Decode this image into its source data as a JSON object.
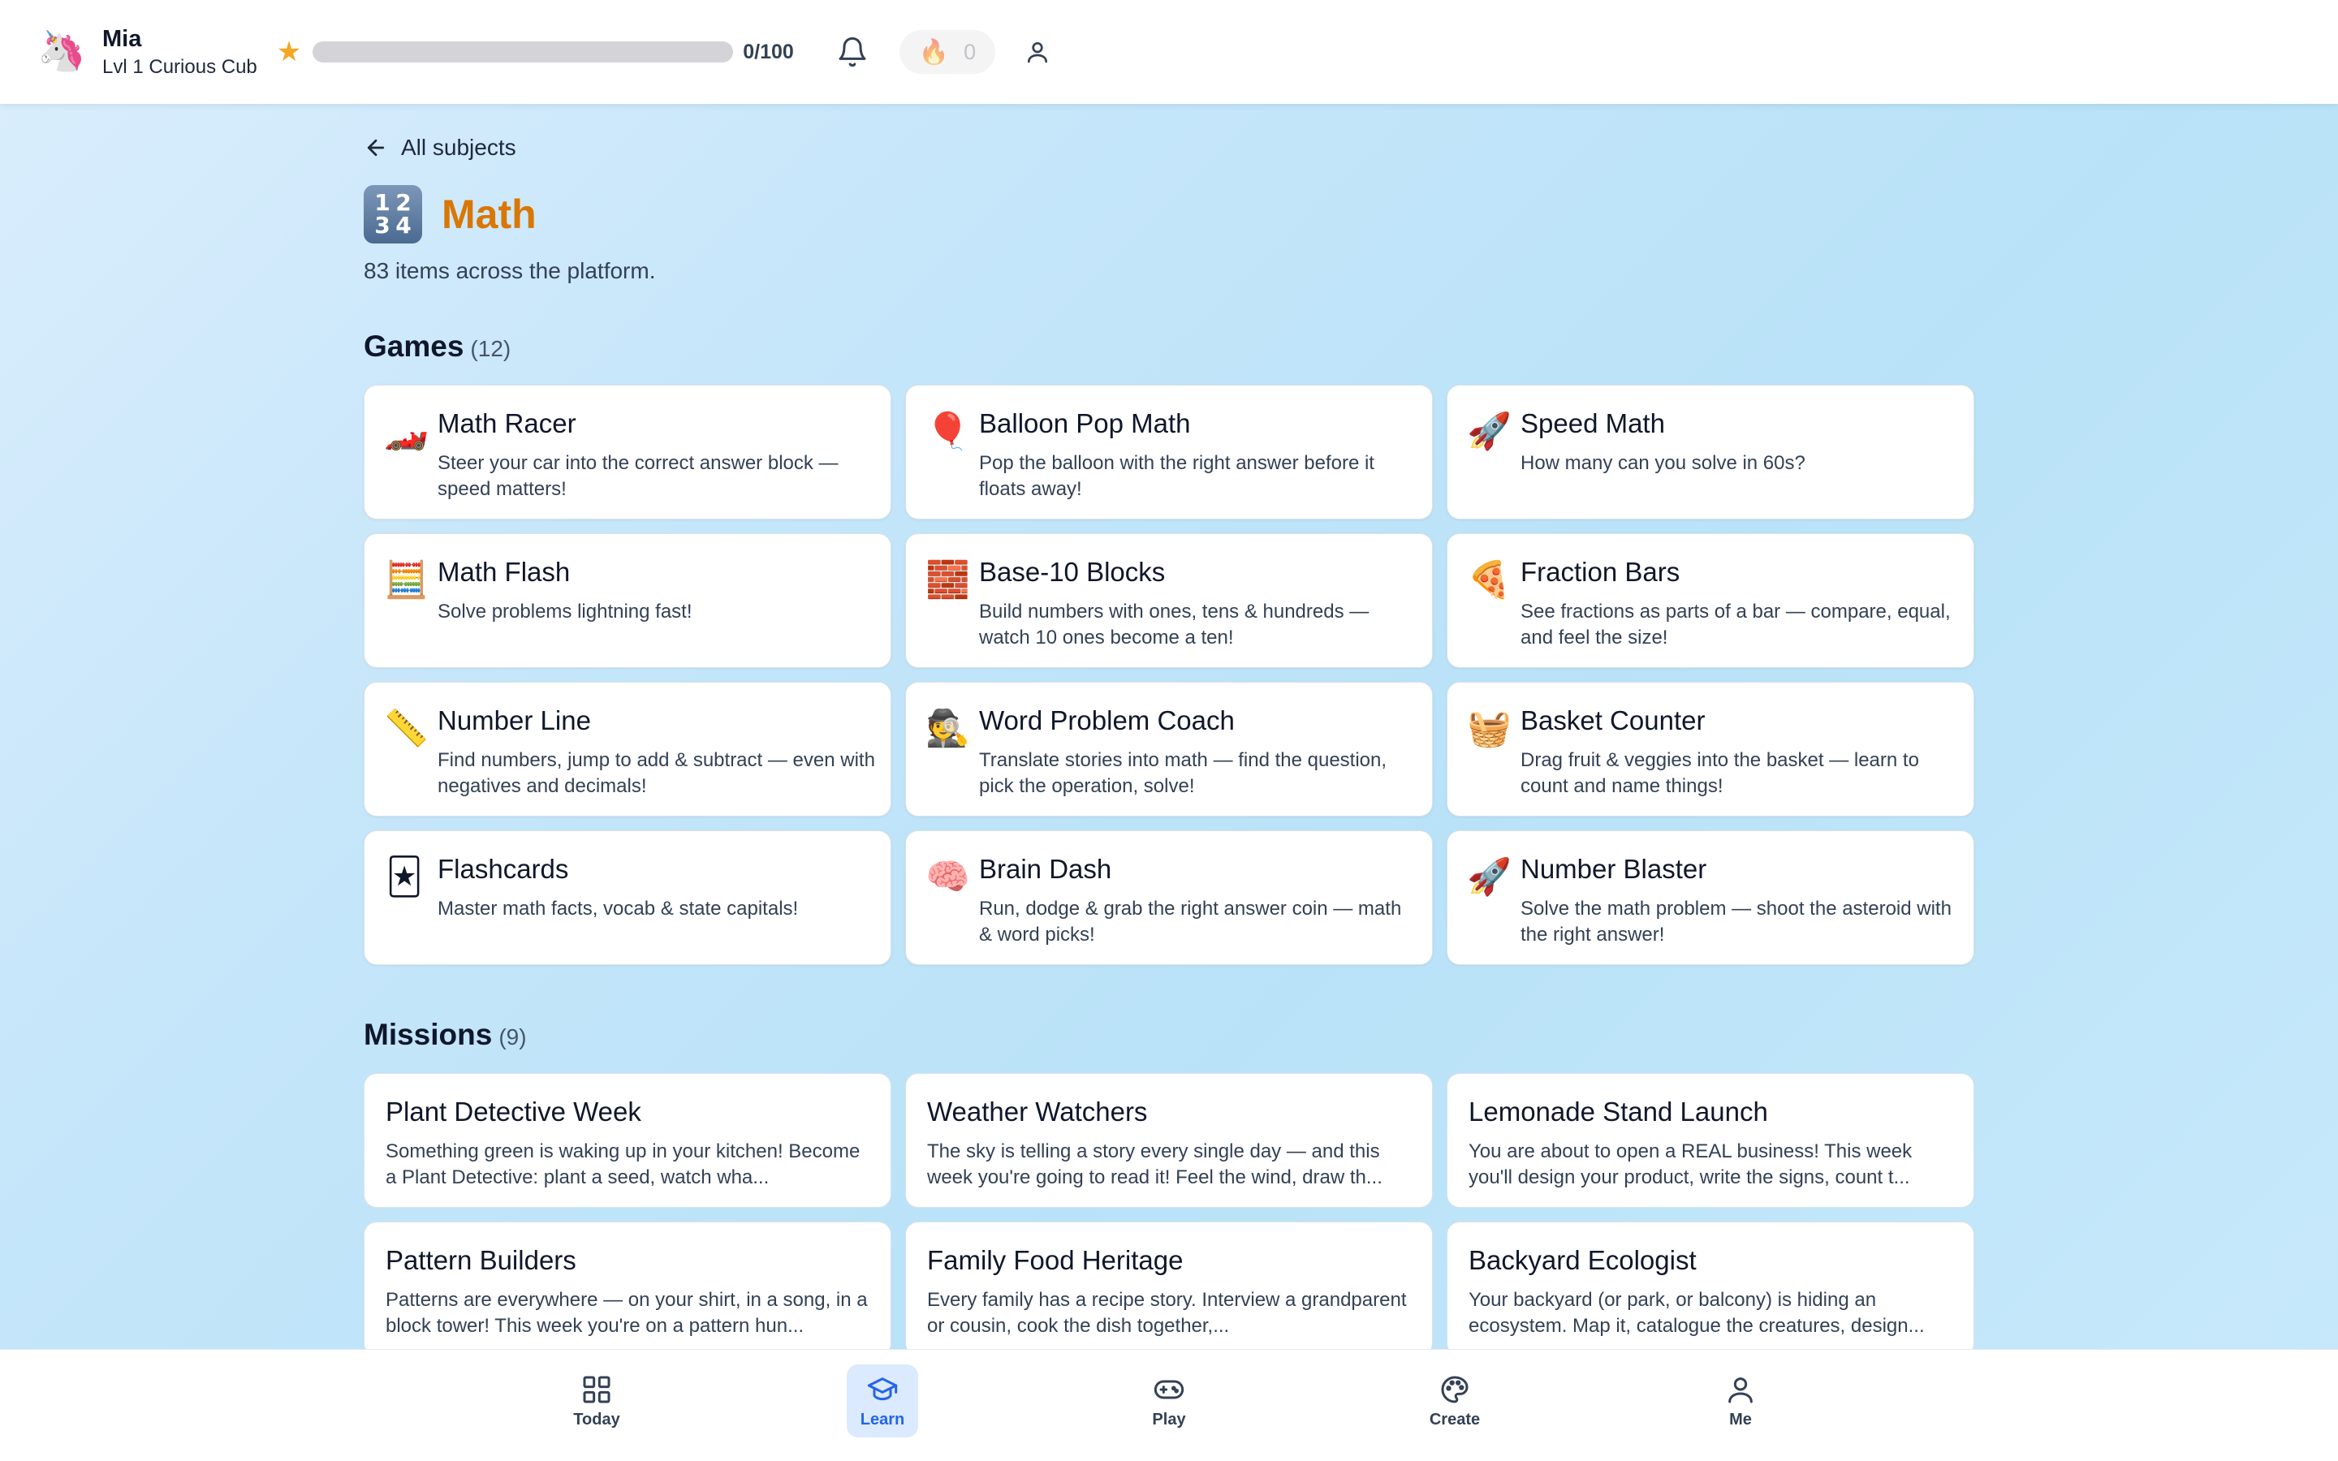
{
  "header": {
    "avatar_emoji": "🦄",
    "user_name": "Mia",
    "user_level": "Lvl 1 Curious Cub",
    "xp_fraction": 0,
    "xp_text": "0/100",
    "streak_icon": "🔥",
    "streak_count": "0",
    "icons": [
      "star-icon",
      "bell-icon",
      "flame-icon",
      "user-icon"
    ]
  },
  "back_link": {
    "label": "All subjects"
  },
  "subject": {
    "icon_digits": [
      "1",
      "2",
      "3",
      "4"
    ],
    "title": "Math",
    "description": "83 items across the platform."
  },
  "games": {
    "title": "Games",
    "count": "(12)",
    "items": [
      {
        "icon": "🏎️",
        "title": "Math Racer",
        "desc": "Steer your car into the correct answer block — speed matters!"
      },
      {
        "icon": "🎈",
        "title": "Balloon Pop Math",
        "desc": "Pop the balloon with the right answer before it floats away!"
      },
      {
        "icon": "🚀",
        "title": "Speed Math",
        "desc": "How many can you solve in 60s?"
      },
      {
        "icon": "🧮",
        "title": "Math Flash",
        "desc": "Solve problems lightning fast!"
      },
      {
        "icon": "🧱",
        "title": "Base-10 Blocks",
        "desc": "Build numbers with ones, tens & hundreds — watch 10 ones become a ten!"
      },
      {
        "icon": "🍕",
        "title": "Fraction Bars",
        "desc": "See fractions as parts of a bar — compare, equal, and feel the size!"
      },
      {
        "icon": "📏",
        "title": "Number Line",
        "desc": "Find numbers, jump to add & subtract — even with negatives and decimals!"
      },
      {
        "icon": "🕵️",
        "title": "Word Problem Coach",
        "desc": "Translate stories into math — find the question, pick the operation, solve!"
      },
      {
        "icon": "🧺",
        "title": "Basket Counter",
        "desc": "Drag fruit & veggies into the basket — learn to count and name things!"
      },
      {
        "icon": "🃏",
        "title": "Flashcards",
        "desc": "Master math facts, vocab & state capitals!"
      },
      {
        "icon": "🧠",
        "title": "Brain Dash",
        "desc": "Run, dodge & grab the right answer coin — math & word picks!"
      },
      {
        "icon": "🚀",
        "title": "Number Blaster",
        "desc": "Solve the math problem — shoot the asteroid with the right answer!"
      }
    ]
  },
  "missions": {
    "title": "Missions",
    "count": "(9)",
    "items": [
      {
        "title": "Plant Detective Week",
        "desc": "Something green is waking up in your kitchen! Become a Plant Detective: plant a seed, watch wha..."
      },
      {
        "title": "Weather Watchers",
        "desc": "The sky is telling a story every single day — and this week you're going to read it! Feel the wind, draw th..."
      },
      {
        "title": "Lemonade Stand Launch",
        "desc": "You are about to open a REAL business! This week you'll design your product, write the signs, count t..."
      },
      {
        "title": "Pattern Builders",
        "desc": "Patterns are everywhere — on your shirt, in a song, in a block tower! This week you're on a pattern hun..."
      },
      {
        "title": "Family Food Heritage",
        "desc": "Every family has a recipe story. Interview a grandparent or cousin, cook the dish together,..."
      },
      {
        "title": "Backyard Ecologist",
        "desc": "Your backyard (or park, or balcony) is hiding an ecosystem. Map it, catalogue the creatures, design..."
      }
    ]
  },
  "bottom_nav": {
    "active": "Learn",
    "items": [
      {
        "label": "Today",
        "icon": "grid-icon"
      },
      {
        "label": "Learn",
        "icon": "graduation-cap-icon"
      },
      {
        "label": "Play",
        "icon": "gamepad-icon"
      },
      {
        "label": "Create",
        "icon": "palette-icon"
      },
      {
        "label": "Me",
        "icon": "user-icon"
      }
    ]
  },
  "colors": {
    "accent_orange": "#d97706",
    "nav_active": "#2563eb",
    "nav_active_bg": "#dbeafe",
    "star": "#f5a623"
  }
}
